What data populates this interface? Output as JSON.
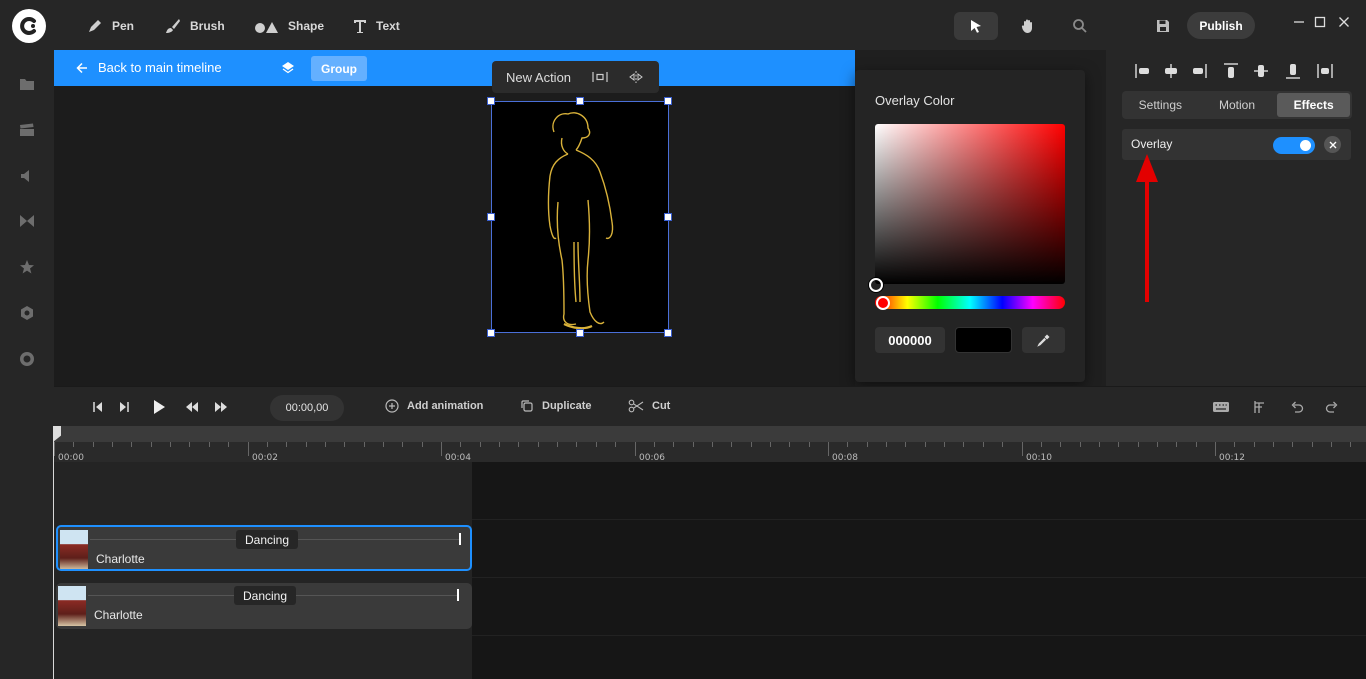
{
  "toolbar": {
    "tools": [
      {
        "label": "Pen",
        "icon": "pen-icon"
      },
      {
        "label": "Brush",
        "icon": "brush-icon"
      },
      {
        "label": "Shape",
        "icon": "shape-icon"
      },
      {
        "label": "Text",
        "icon": "text-icon"
      }
    ],
    "publish_label": "Publish"
  },
  "sidebar": {
    "icons": [
      "folder-icon",
      "clapper-icon",
      "speaker-icon",
      "transition-icon",
      "star-icon",
      "hexagon-icon",
      "record-icon"
    ]
  },
  "canvas": {
    "back_label": "Back to main timeline",
    "group_label": "Group",
    "new_action_label": "New Action",
    "stage_color": "#000000"
  },
  "color_popover": {
    "title": "Overlay Color",
    "hex_value": "000000",
    "selected_color": "#000000"
  },
  "right_panel": {
    "tabs": [
      {
        "label": "Settings",
        "active": false
      },
      {
        "label": "Motion",
        "active": false
      },
      {
        "label": "Effects",
        "active": true
      }
    ],
    "overlay_label": "Overlay",
    "overlay_enabled": true
  },
  "timeline": {
    "time_value": "00:00,00",
    "actions": {
      "add_animation": "Add animation",
      "duplicate": "Duplicate",
      "cut": "Cut"
    },
    "ruler_labels": [
      "00:00",
      "00:02",
      "00:04",
      "00:06",
      "00:08",
      "00:10",
      "00:12"
    ],
    "clips": [
      {
        "name": "Charlotte",
        "tag": "Dancing",
        "selected": true
      },
      {
        "name": "Charlotte",
        "tag": "Dancing",
        "selected": false
      }
    ]
  },
  "colors": {
    "accent": "#1e90ff",
    "annotation_arrow": "#e30000"
  }
}
